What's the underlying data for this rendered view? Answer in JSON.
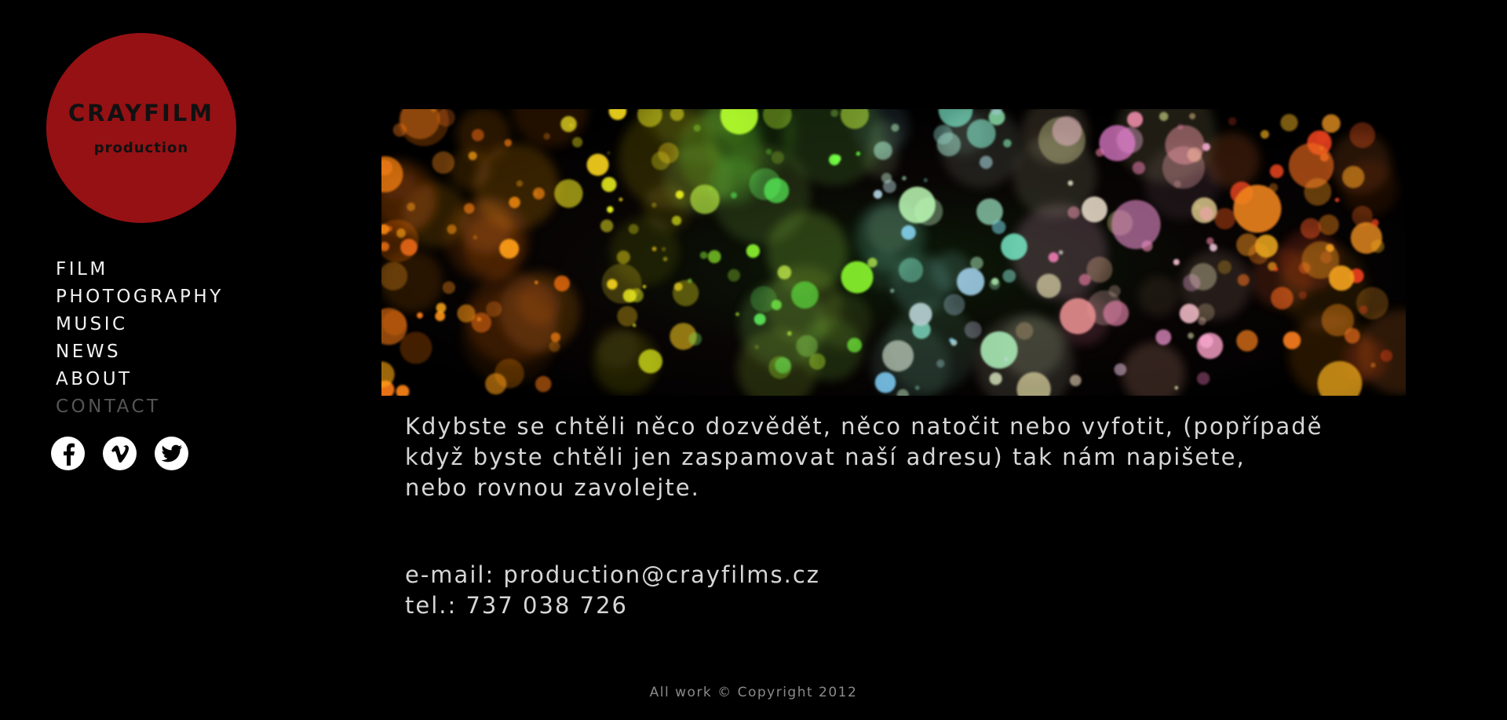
{
  "logo": {
    "title": "CRAYFILM",
    "subtitle": "production",
    "color": "#961114"
  },
  "nav": {
    "items": [
      {
        "label": "FILM"
      },
      {
        "label": "PHOTOGRAPHY"
      },
      {
        "label": "MUSIC"
      },
      {
        "label": "NEWS"
      },
      {
        "label": "ABOUT"
      },
      {
        "label": "CONTACT",
        "active": true
      }
    ]
  },
  "social": {
    "icons": [
      "facebook-icon",
      "vimeo-icon",
      "twitter-icon"
    ]
  },
  "banner": {
    "image": "colorful-bokeh-lights"
  },
  "content": {
    "intro": "Kdybste se chtěli něco dozvědět, něco natočit nebo vyfotit, (popřípadě\nkdyž byste chtěli jen zaspamovat naší adresu)  tak nám napišete,\nnebo rovnou zavolejte.",
    "email": "e-mail: production@crayfilms.cz",
    "phone": "tel.: 737 038 726"
  },
  "footer": {
    "copyright": "All work © Copyright 2012"
  }
}
